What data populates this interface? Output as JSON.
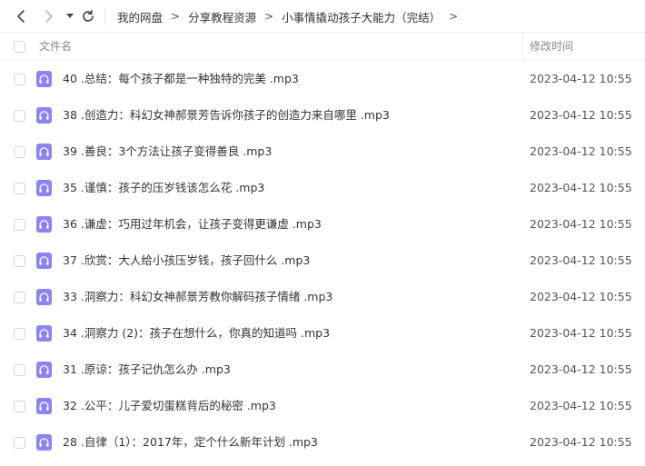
{
  "toolbar": {
    "back_icon": "chevron-left-icon",
    "forward_icon": "chevron-right-icon",
    "dropdown_icon": "caret-down-icon",
    "refresh_icon": "refresh-icon"
  },
  "breadcrumb": {
    "items": [
      "我的网盘",
      "分享教程资源",
      "小事情撬动孩子大能力（完结）"
    ],
    "separator": ">"
  },
  "table": {
    "columns": {
      "name": "文件名",
      "modified": "修改时间"
    },
    "rows": [
      {
        "name": "40 .总结：每个孩子都是一种独特的完美 .mp3",
        "modified": "2023-04-12 10:55",
        "icon": "audio-file-icon"
      },
      {
        "name": "38 .创造力：科幻女神郝景芳告诉你孩子的创造力来自哪里 .mp3",
        "modified": "2023-04-12 10:55",
        "icon": "audio-file-icon"
      },
      {
        "name": "39 .善良：3个方法让孩子变得善良 .mp3",
        "modified": "2023-04-12 10:55",
        "icon": "audio-file-icon"
      },
      {
        "name": "35 .谨慎：孩子的压岁钱该怎么花 .mp3",
        "modified": "2023-04-12 10:55",
        "icon": "audio-file-icon"
      },
      {
        "name": "36 .谦虚：巧用过年机会，让孩子变得更谦虚 .mp3",
        "modified": "2023-04-12 10:55",
        "icon": "audio-file-icon"
      },
      {
        "name": "37 .欣赏：大人给小孩压岁钱，孩子回什么 .mp3",
        "modified": "2023-04-12 10:55",
        "icon": "audio-file-icon"
      },
      {
        "name": "33 .洞察力：科幻女神郝景芳教你解码孩子情绪 .mp3",
        "modified": "2023-04-12 10:55",
        "icon": "audio-file-icon"
      },
      {
        "name": "34 .洞察力 (2)：孩子在想什么，你真的知道吗 .mp3",
        "modified": "2023-04-12 10:55",
        "icon": "audio-file-icon"
      },
      {
        "name": "31 .原谅：孩子记仇怎么办 .mp3",
        "modified": "2023-04-12 10:55",
        "icon": "audio-file-icon"
      },
      {
        "name": "32 .公平：儿子爱切蛋糕背后的秘密 .mp3",
        "modified": "2023-04-12 10:55",
        "icon": "audio-file-icon"
      },
      {
        "name": "28 .自律（1）：2017年，定个什么新年计划 .mp3",
        "modified": "2023-04-12 10:55",
        "icon": "audio-file-icon"
      }
    ]
  },
  "colors": {
    "audio_icon": "#8c84f0",
    "text": "#333333",
    "muted": "#888888"
  }
}
